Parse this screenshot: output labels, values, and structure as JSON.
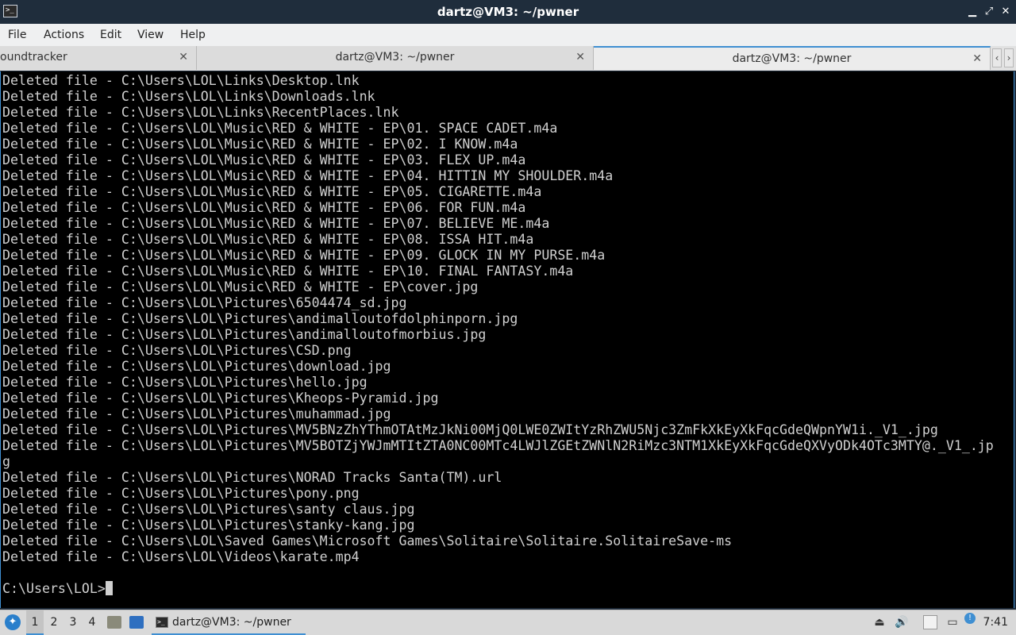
{
  "window": {
    "title": "dartz@VM3: ~/pwner",
    "app_icon_glyph": ">_",
    "minimize_glyph": "▁",
    "maximize_glyph": "⤢",
    "close_glyph": "✕"
  },
  "menu": [
    "File",
    "Actions",
    "Edit",
    "View",
    "Help"
  ],
  "tabs": [
    {
      "label": "oundtracker",
      "close": "✕"
    },
    {
      "label": "dartz@VM3: ~/pwner",
      "close": "✕"
    },
    {
      "label": "dartz@VM3: ~/pwner",
      "close": "✕"
    }
  ],
  "tab_scroll": {
    "left": "‹",
    "right": "›"
  },
  "terminal": {
    "lines": [
      "Deleted file - C:\\Users\\LOL\\Links\\Desktop.lnk",
      "Deleted file - C:\\Users\\LOL\\Links\\Downloads.lnk",
      "Deleted file - C:\\Users\\LOL\\Links\\RecentPlaces.lnk",
      "Deleted file - C:\\Users\\LOL\\Music\\RED & WHITE - EP\\01. SPACE CADET.m4a",
      "Deleted file - C:\\Users\\LOL\\Music\\RED & WHITE - EP\\02. I KNOW.m4a",
      "Deleted file - C:\\Users\\LOL\\Music\\RED & WHITE - EP\\03. FLEX UP.m4a",
      "Deleted file - C:\\Users\\LOL\\Music\\RED & WHITE - EP\\04. HITTIN MY SHOULDER.m4a",
      "Deleted file - C:\\Users\\LOL\\Music\\RED & WHITE - EP\\05. CIGARETTE.m4a",
      "Deleted file - C:\\Users\\LOL\\Music\\RED & WHITE - EP\\06. FOR FUN.m4a",
      "Deleted file - C:\\Users\\LOL\\Music\\RED & WHITE - EP\\07. BELIEVE ME.m4a",
      "Deleted file - C:\\Users\\LOL\\Music\\RED & WHITE - EP\\08. ISSA HIT.m4a",
      "Deleted file - C:\\Users\\LOL\\Music\\RED & WHITE - EP\\09. GLOCK IN MY PURSE.m4a",
      "Deleted file - C:\\Users\\LOL\\Music\\RED & WHITE - EP\\10. FINAL FANTASY.m4a",
      "Deleted file - C:\\Users\\LOL\\Music\\RED & WHITE - EP\\cover.jpg",
      "Deleted file - C:\\Users\\LOL\\Pictures\\6504474_sd.jpg",
      "Deleted file - C:\\Users\\LOL\\Pictures\\andimalloutofdolphinporn.jpg",
      "Deleted file - C:\\Users\\LOL\\Pictures\\andimalloutofmorbius.jpg",
      "Deleted file - C:\\Users\\LOL\\Pictures\\CSD.png",
      "Deleted file - C:\\Users\\LOL\\Pictures\\download.jpg",
      "Deleted file - C:\\Users\\LOL\\Pictures\\hello.jpg",
      "Deleted file - C:\\Users\\LOL\\Pictures\\Kheops-Pyramid.jpg",
      "Deleted file - C:\\Users\\LOL\\Pictures\\muhammad.jpg",
      "Deleted file - C:\\Users\\LOL\\Pictures\\MV5BNzZhYThmOTAtMzJkNi00MjQ0LWE0ZWItYzRhZWU5Njc3ZmFkXkEyXkFqcGdeQWpnYW1i._V1_.jpg",
      "Deleted file - C:\\Users\\LOL\\Pictures\\MV5BOTZjYWJmMTItZTA0NC00MTc4LWJlZGEtZWNlN2RiMzc3NTM1XkEyXkFqcGdeQXVyODk4OTc3MTY@._V1_.jp",
      "g",
      "Deleted file - C:\\Users\\LOL\\Pictures\\NORAD Tracks Santa(TM).url",
      "Deleted file - C:\\Users\\LOL\\Pictures\\pony.png",
      "Deleted file - C:\\Users\\LOL\\Pictures\\santy claus.jpg",
      "Deleted file - C:\\Users\\LOL\\Pictures\\stanky-kang.jpg",
      "Deleted file - C:\\Users\\LOL\\Saved Games\\Microsoft Games\\Solitaire\\Solitaire.SolitaireSave-ms",
      "Deleted file - C:\\Users\\LOL\\Videos\\karate.mp4",
      ""
    ],
    "prompt": "C:\\Users\\LOL>"
  },
  "taskbar": {
    "workspaces": [
      "1",
      "2",
      "3",
      "4"
    ],
    "active_workspace": "1",
    "task_label": "dartz@VM3: ~/pwner",
    "task_icon_glyph": ">_",
    "start_glyph": "✦",
    "tray_glyphs": {
      "volume": "🔊",
      "notification": "!"
    },
    "clock": "7:41"
  },
  "colors": {
    "accent": "#3f8fd2",
    "terminal_bg": "#000000",
    "terminal_fg": "#d0d0d0",
    "titlebar": "#1f2d3c"
  }
}
